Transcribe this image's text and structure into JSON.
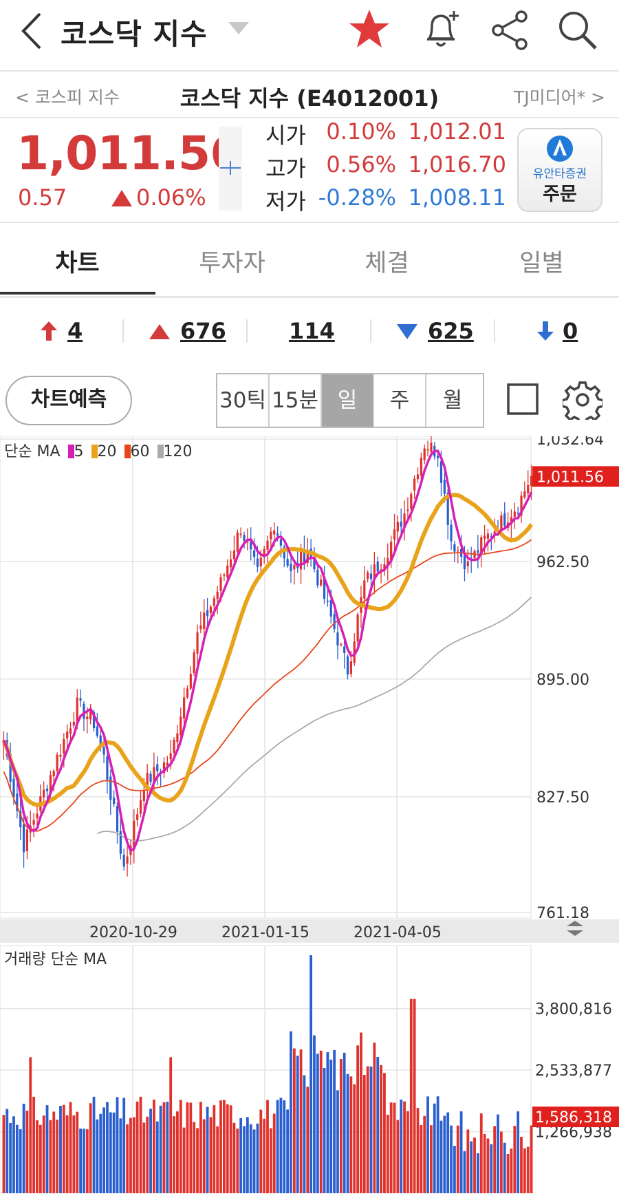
{
  "header": {
    "title": "코스닥 지수",
    "icons": [
      "back-arrow-icon",
      "dropdown-caret-icon",
      "star-icon",
      "bell-plus-icon",
      "share-icon",
      "search-icon"
    ],
    "star_color": "#e03a3a"
  },
  "subheader": {
    "prev": "< 코스피 지수",
    "center": "코스닥 지수 (E4012001)",
    "next": "TJ미디어* >"
  },
  "price": {
    "current": "1,011.56",
    "change": "0.57",
    "change_pct": "0.06%",
    "rows": [
      {
        "label": "시가",
        "pct": "0.10%",
        "value": "1,012.01",
        "color": "red"
      },
      {
        "label": "고가",
        "pct": "0.56%",
        "value": "1,016.70",
        "color": "red"
      },
      {
        "label": "저가",
        "pct": "-0.28%",
        "value": "1,008.11",
        "color": "blue"
      }
    ],
    "order": {
      "brand": "유안타증권",
      "label": "주문"
    }
  },
  "tabs": [
    "차트",
    "투자자",
    "체결",
    "일별"
  ],
  "breadth": {
    "upper_limit": "4",
    "up": "676",
    "unchanged": "114",
    "down": "625",
    "lower_limit": "0"
  },
  "toolbar": {
    "predict": "차트예측",
    "periods": [
      "30틱",
      "15분",
      "일",
      "주",
      "월"
    ],
    "active_period": "일"
  },
  "chart_data": [
    {
      "type": "candlestick",
      "legend_title": "단순 MA",
      "ma_series": [
        {
          "name": "5",
          "color": "#d61fb5"
        },
        {
          "name": "20",
          "color": "#e8a31a"
        },
        {
          "name": "60",
          "color": "#e8461a"
        },
        {
          "name": "120",
          "color": "#aaaaaa"
        }
      ],
      "y_ticks": [
        "1,032.64",
        "962.50",
        "895.00",
        "827.50",
        "761.18"
      ],
      "ylim": [
        761.18,
        1032.64
      ],
      "current_label": "1,011.56",
      "x_ticks": [
        "2020-10-29",
        "2021-01-15",
        "2021-04-05"
      ],
      "key_points": [
        {
          "i": 0,
          "close": 860
        },
        {
          "i": 6,
          "close": 800
        },
        {
          "i": 12,
          "close": 830
        },
        {
          "i": 22,
          "close": 880
        },
        {
          "i": 27,
          "close": 870
        },
        {
          "i": 30,
          "close": 850
        },
        {
          "i": 36,
          "close": 787
        },
        {
          "i": 42,
          "close": 835
        },
        {
          "i": 50,
          "close": 850
        },
        {
          "i": 58,
          "close": 920
        },
        {
          "i": 65,
          "close": 950
        },
        {
          "i": 71,
          "close": 982
        },
        {
          "i": 76,
          "close": 955
        },
        {
          "i": 81,
          "close": 985
        },
        {
          "i": 86,
          "close": 955
        },
        {
          "i": 91,
          "close": 970
        },
        {
          "i": 98,
          "close": 930
        },
        {
          "i": 103,
          "close": 900
        },
        {
          "i": 108,
          "close": 950
        },
        {
          "i": 114,
          "close": 965
        },
        {
          "i": 120,
          "close": 990
        },
        {
          "i": 126,
          "close": 1030
        },
        {
          "i": 130,
          "close": 1025
        },
        {
          "i": 134,
          "close": 975
        },
        {
          "i": 139,
          "close": 960
        },
        {
          "i": 144,
          "close": 975
        },
        {
          "i": 149,
          "close": 985
        },
        {
          "i": 154,
          "close": 995
        },
        {
          "i": 158,
          "close": 1011.56
        }
      ]
    },
    {
      "type": "bar",
      "title": "거래량 단순 MA",
      "y_ticks": [
        "3,800,816",
        "2,533,877",
        "1,266,938"
      ],
      "current_label": "1,586,318",
      "ylim": [
        0,
        5100000
      ]
    }
  ]
}
